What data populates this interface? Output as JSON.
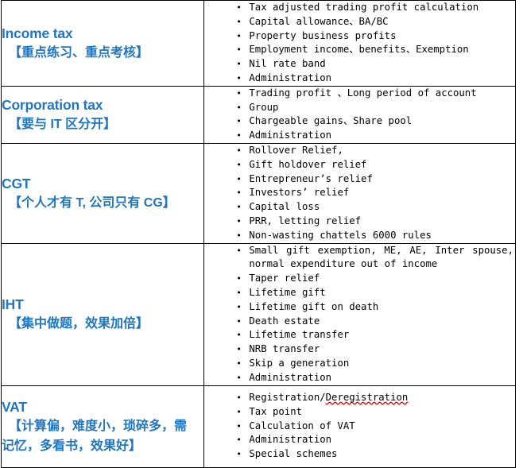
{
  "document": {
    "type": "table",
    "accent_color": "#1F76C4",
    "border_color": "#000000",
    "spellcheck_underline_color": "#D40000"
  },
  "rows": [
    {
      "id": "income-tax",
      "topic_en": "Income tax",
      "topic_cn": "【重点练习、重点考核】",
      "points": [
        "Tax adjusted trading profit calculation",
        "Capital allowance、BA/BC",
        "Property business profits",
        "Employment income、benefits、Exemption",
        "Nil rate band",
        "Administration"
      ]
    },
    {
      "id": "corporation-tax",
      "topic_en": "Corporation tax",
      "topic_cn": "【要与 IT 区分开】",
      "points": [
        "Trading profit 、Long period of account",
        "Group",
        "Chargeable gains、Share pool",
        "Administration"
      ]
    },
    {
      "id": "cgt",
      "topic_en": "CGT",
      "topic_cn": "【个人才有 T, 公司只有 CG】",
      "points": [
        "Rollover Relief,",
        "Gift holdover relief",
        "Entrepreneur’s relief",
        "Investors’ relief",
        "Capital loss",
        "PRR, letting relief",
        "Non-wasting chattels 6000 rules"
      ]
    },
    {
      "id": "iht",
      "topic_en": "IHT",
      "topic_cn": "【集中做题，效果加倍】",
      "points": [
        "Small gift exemption, ME, AE, Inter spouse, normal expenditure out of income",
        "Taper relief",
        "Lifetime gift",
        "Lifetime gift on death",
        "Death estate",
        "Lifetime transfer",
        "NRB transfer",
        "Skip a generation",
        "Administration"
      ]
    },
    {
      "id": "vat",
      "topic_en": "VAT",
      "topic_cn_line1": "【计算偏，难度小，琐碎多，需",
      "topic_cn_line2": "记忆，多看书，效果好】",
      "points": [
        "Registration/Deregistration",
        "Tax point",
        "Calculation of VAT",
        "Administration",
        "Special schemes"
      ],
      "misspelled_word": "Deregistration"
    }
  ],
  "bullet_glyph": "•"
}
